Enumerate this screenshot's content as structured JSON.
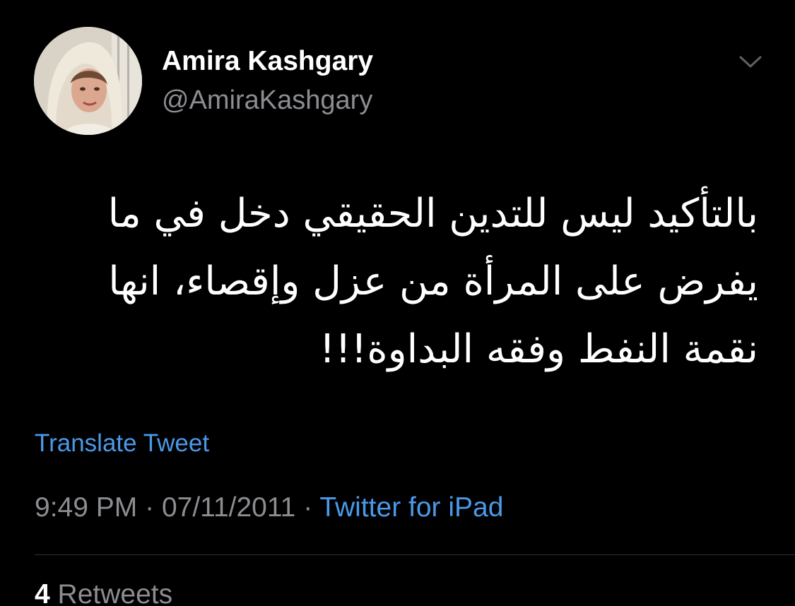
{
  "tweet": {
    "author": {
      "display_name": "Amira Kashgary",
      "handle": "@AmiraKashgary"
    },
    "text_lines": [
      "بالتأكيد ليس للتدين الحقيقي دخل في ما",
      "يفرض على المرأة من عزل وإقصاء، انها",
      "نقمة النفط وفقه البداوة!!!"
    ],
    "translate_label": "Translate Tweet",
    "time": "9:49 PM",
    "separator": "·",
    "date": "07/11/2011",
    "source": "Twitter for iPad",
    "retweets": {
      "count": "4",
      "label": "Retweets"
    }
  },
  "icons": {
    "more": "chevron-down-icon"
  },
  "colors": {
    "background": "#000000",
    "primary_text": "#ffffff",
    "secondary_text": "#8b8d91",
    "link": "#4a99e9",
    "divider": "#2f3336"
  }
}
